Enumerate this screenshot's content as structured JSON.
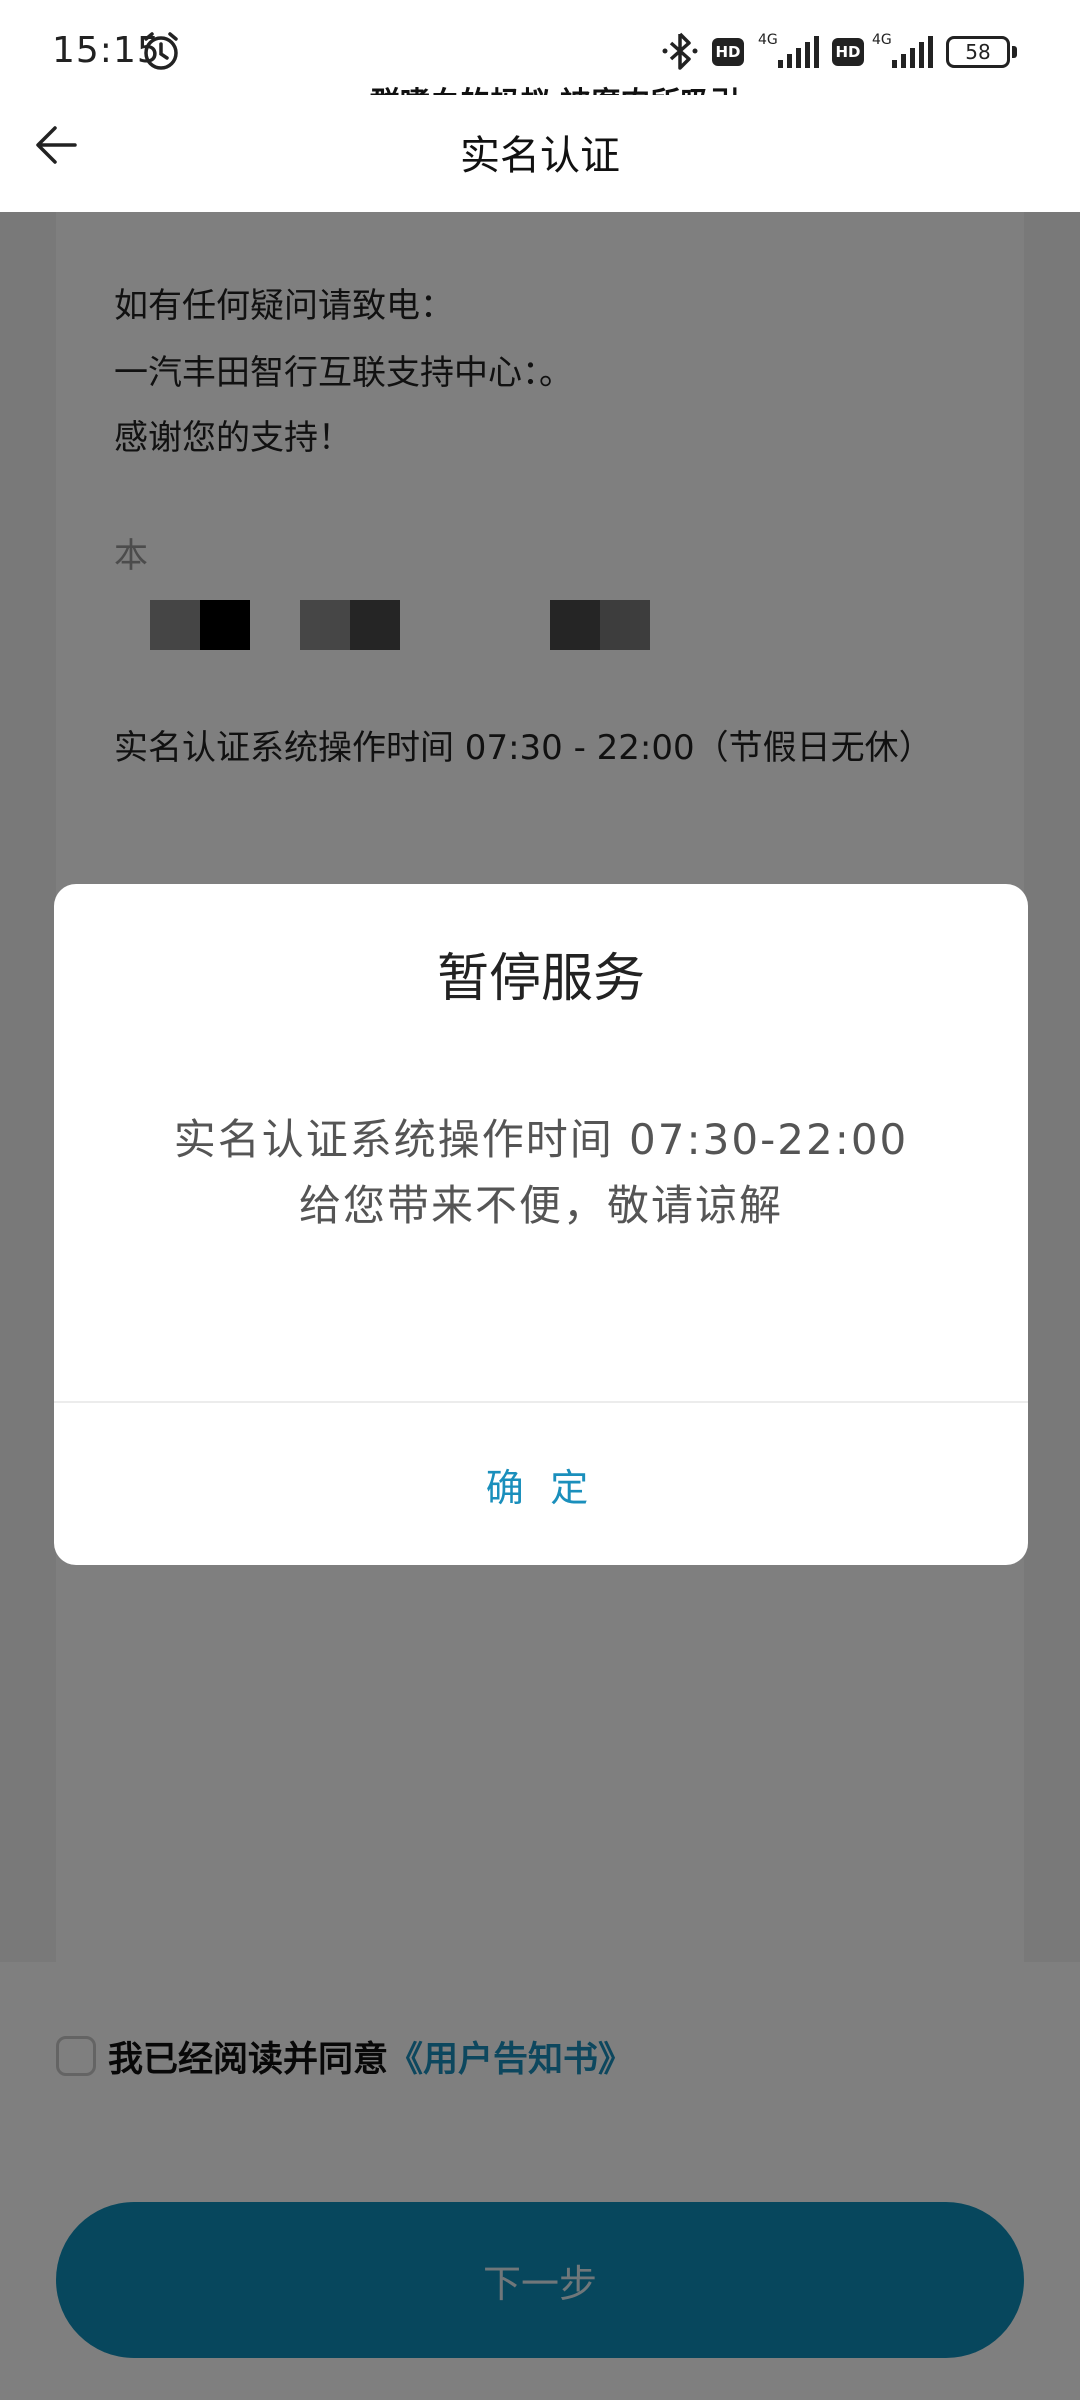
{
  "status_bar": {
    "time": "15:15",
    "hd_1": "HD",
    "hd_2": "HD",
    "net_1": "4G",
    "net_2": "4G",
    "battery": "58"
  },
  "ticker": {
    "text": "一群嗜血的蚂蚁 被腐肉所吸引"
  },
  "header": {
    "title": "实名认证"
  },
  "content": {
    "line_1": "如有任何疑问请致电：",
    "line_2": "一汽丰田智行互联支持中心：。",
    "line_3": "感谢您的支持！",
    "line_4": "本",
    "line_5": "实名认证系统操作时间 07:30 - 22:00（节假日无休）"
  },
  "agreement": {
    "text": "我已经阅读并同意",
    "link": "《用户告知书》"
  },
  "next_button": {
    "label": "下一步"
  },
  "dialog": {
    "title": "暂停服务",
    "message_1": "实名认证系统操作时间 07:30-22:00",
    "message_2": "给您带来不便，敬请谅解",
    "confirm": "确 定"
  },
  "colors": {
    "accent": "#1a8fbc",
    "button": "#0e8fba",
    "overlay": "rgba(0,0,0,0.5)"
  }
}
